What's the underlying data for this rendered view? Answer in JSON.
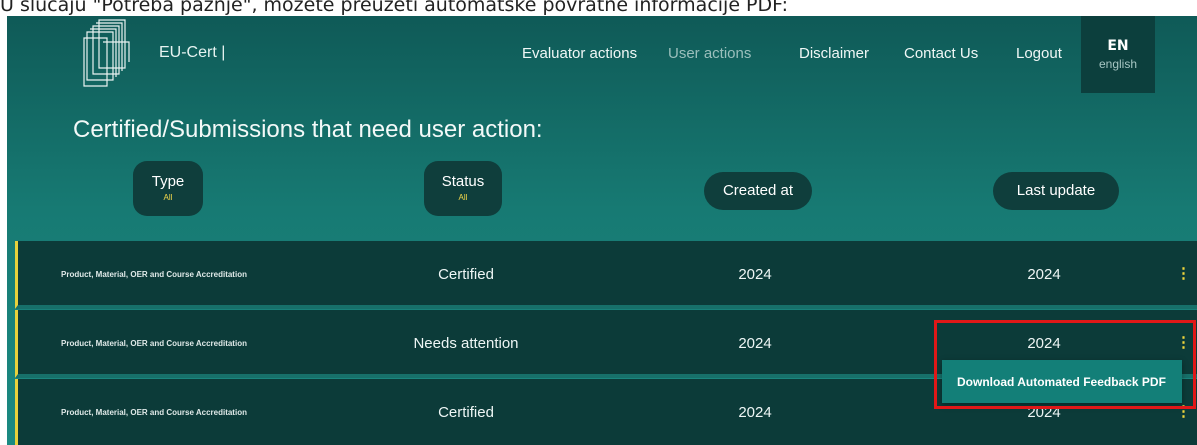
{
  "caption": "U slučaju \"Potreba pažnje\", možete preuzeti automatske povratne informacije PDF:",
  "header": {
    "brand": "EU-Cert |",
    "nav": [
      "Evaluator actions",
      "User actions",
      "Disclaimer",
      "Contact Us",
      "Logout"
    ],
    "active_nav": "User actions",
    "lang": {
      "code": "EN",
      "name": "english"
    }
  },
  "page": {
    "title": "Certified/Submissions that need user action:"
  },
  "filters": {
    "type": {
      "label": "Type",
      "value": "All"
    },
    "status": {
      "label": "Status",
      "value": "All"
    },
    "created": {
      "label": "Created at"
    },
    "last_update": {
      "label": "Last update"
    }
  },
  "rows": [
    {
      "type": "Product, Material, OER and Course Accreditation",
      "status": "Certified",
      "created": "2024",
      "updated": "2024"
    },
    {
      "type": "Product, Material, OER and Course Accreditation",
      "status": "Needs attention",
      "created": "2024",
      "updated": "2024"
    },
    {
      "type": "Product, Material, OER and Course Accreditation",
      "status": "Certified",
      "created": "2024",
      "updated": "2024"
    }
  ],
  "row_menu_glyph": "⋮",
  "dropdown": {
    "item": "Download Automated Feedback PDF"
  },
  "colors": {
    "accent": "#e8d13c",
    "highlight": "#e01818",
    "row_bg": "#0c3b39"
  }
}
